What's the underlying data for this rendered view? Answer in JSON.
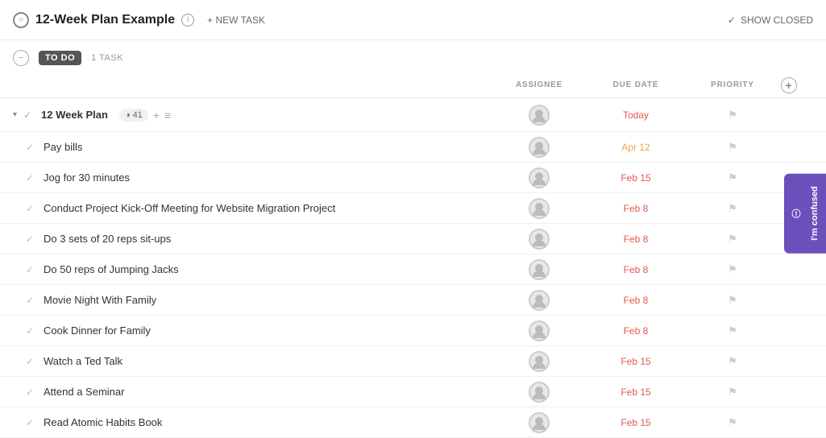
{
  "header": {
    "circle_icon": "○",
    "title": "12-Week Plan Example",
    "info_label": "i",
    "new_task_label": "+ NEW TASK",
    "show_closed_check": "✓",
    "show_closed_label": "SHOW CLOSED"
  },
  "section": {
    "collapse_icon": "−",
    "todo_label": "TO DO",
    "task_count": "1 TASK"
  },
  "table_headers": {
    "assignee": "ASSIGNEE",
    "due_date": "DUE DATE",
    "priority": "PRIORITY"
  },
  "parent_task": {
    "expand": "▾",
    "check": "✓",
    "name": "12 Week Plan",
    "tag_icon": "◑",
    "tag_count": "41",
    "add_icon": "+",
    "list_icon": "≡",
    "date": "Today",
    "date_class": "today"
  },
  "tasks": [
    {
      "name": "Pay bills",
      "date": "Apr 12",
      "date_class": "upcoming"
    },
    {
      "name": "Jog for 30 minutes",
      "date": "Feb 15",
      "date_class": "overdue"
    },
    {
      "name": "Conduct Project Kick-Off Meeting for Website Migration Project",
      "date": "Feb 8",
      "date_class": "overdue"
    },
    {
      "name": "Do 3 sets of 20 reps sit-ups",
      "date": "Feb 8",
      "date_class": "overdue"
    },
    {
      "name": "Do 50 reps of Jumping Jacks",
      "date": "Feb 8",
      "date_class": "overdue"
    },
    {
      "name": "Movie Night With Family",
      "date": "Feb 8",
      "date_class": "overdue"
    },
    {
      "name": "Cook Dinner for Family",
      "date": "Feb 8",
      "date_class": "overdue"
    },
    {
      "name": "Watch a Ted Talk",
      "date": "Feb 15",
      "date_class": "overdue"
    },
    {
      "name": "Attend a Seminar",
      "date": "Feb 15",
      "date_class": "overdue"
    },
    {
      "name": "Read Atomic Habits Book",
      "date": "Feb 15",
      "date_class": "overdue"
    }
  ],
  "confused_btn": {
    "label": "I'm confused",
    "icon": "ⓘ"
  }
}
